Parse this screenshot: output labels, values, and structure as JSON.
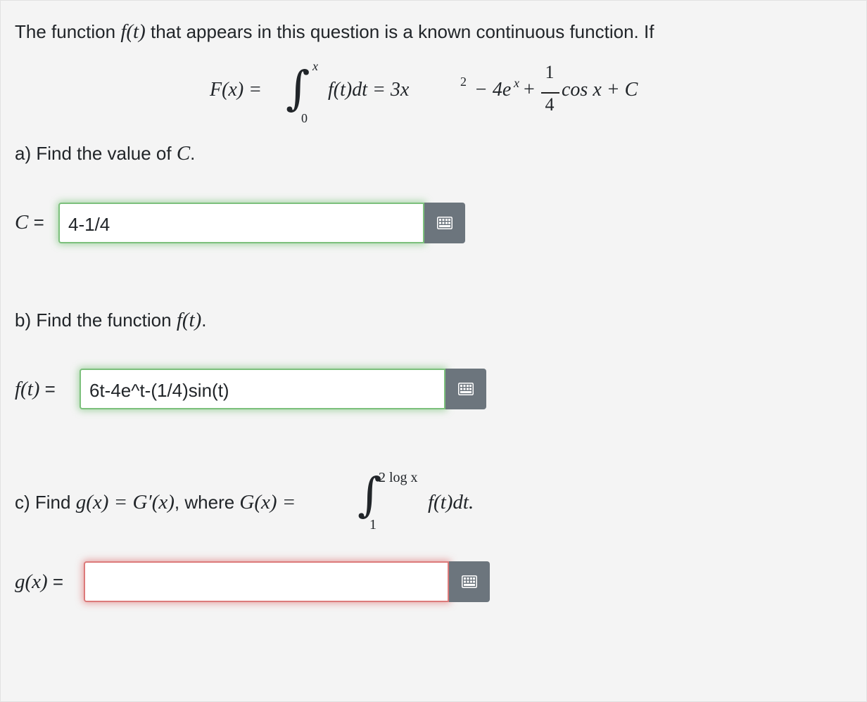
{
  "intro": {
    "text_before": "The function ",
    "f_of_t": "f(t)",
    "text_after": " that appears in this question is a known continuous function. If"
  },
  "equation": {
    "lhs": "F(x) =",
    "upper_limit": "x",
    "lower_limit": "0",
    "integrand": "f(t)dt = 3x",
    "exp2": "2",
    "minus_part": "− 4e",
    "exp_x": "x",
    "plus": "+",
    "frac_num": "1",
    "frac_den": "4",
    "tail": "cos x + C"
  },
  "part_a": {
    "prompt": "a) Find the value of ",
    "var": "C",
    "period": ".",
    "label_var": "C",
    "label_eq": " =",
    "answer": "4-1/4",
    "status": "correct"
  },
  "part_b": {
    "prompt": "b) Find the function ",
    "var": "f(t)",
    "period": ".",
    "label_var": "f(t)",
    "label_eq": " =",
    "answer": "6t-4e^t-(1/4)sin(t)",
    "status": "correct"
  },
  "part_c": {
    "prompt_start": "c) Find ",
    "g_expr": "g(x) = G′(x)",
    "where": ", where ",
    "G_expr": "G(x) =",
    "upper_limit": "2 log x",
    "lower_limit": "1",
    "integrand": "f(t)dt.",
    "label_var": "g(x)",
    "label_eq": " =",
    "answer": "",
    "status": "incorrect"
  },
  "colors": {
    "correct_border": "#7cc07c",
    "incorrect_border": "#dc7a7a",
    "keyboard_button": "#6c757d"
  },
  "icons": {
    "keyboard": "keyboard-icon"
  }
}
